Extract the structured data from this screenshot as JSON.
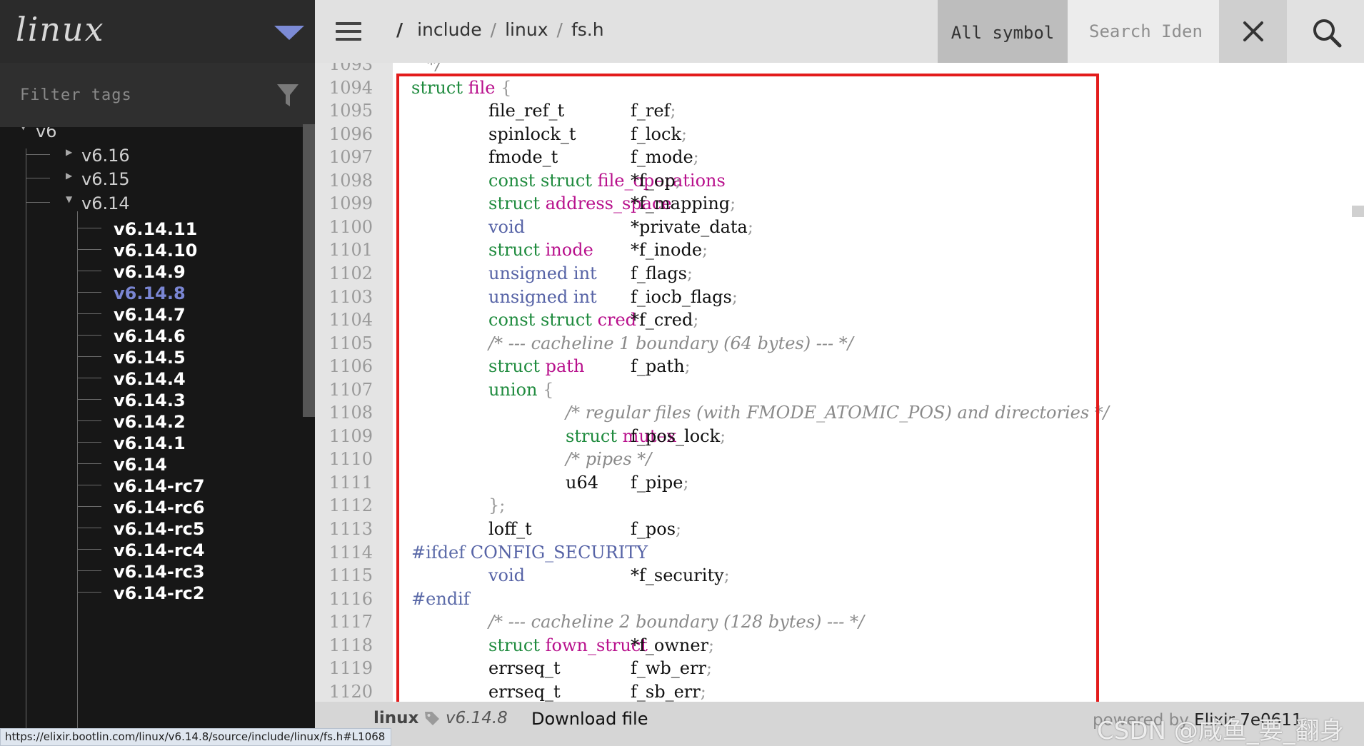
{
  "sidebar": {
    "logo": "linux",
    "filter_placeholder": "Filter tags",
    "tree": {
      "root": "v6",
      "groups": [
        "v6.16",
        "v6.15",
        "v6.14"
      ],
      "versions": [
        "v6.14.11",
        "v6.14.10",
        "v6.14.9",
        "v6.14.8",
        "v6.14.7",
        "v6.14.6",
        "v6.14.5",
        "v6.14.4",
        "v6.14.3",
        "v6.14.2",
        "v6.14.1",
        "v6.14",
        "v6.14-rc7",
        "v6.14-rc6",
        "v6.14-rc5",
        "v6.14-rc4",
        "v6.14-rc3",
        "v6.14-rc2"
      ],
      "active_version": "v6.14.8"
    }
  },
  "topbar": {
    "breadcrumb": [
      "include",
      "linux",
      "fs.h"
    ],
    "root_slash": "/",
    "search_type": "All symbol",
    "search_placeholder": "Search Iden"
  },
  "code": {
    "line_numbers": [
      "1093",
      "1094",
      "1095",
      "1096",
      "1097",
      "1098",
      "1099",
      "1100",
      "1101",
      "1102",
      "1103",
      "1104",
      "1105",
      "1106",
      "1107",
      "1108",
      "1109",
      "1110",
      "1111",
      "1112",
      "1113",
      "1114",
      "1115",
      "1116",
      "1117",
      "1118",
      "1119",
      "1120"
    ],
    "lines": {
      "l1093": "*/",
      "l1094": {
        "kw": "struct",
        "ty": "file",
        "rest": " {"
      },
      "l1095": {
        "type": "file_ref_t",
        "field": "f_ref"
      },
      "l1096": {
        "type": "spinlock_t",
        "field": "f_lock"
      },
      "l1097": {
        "type": "fmode_t",
        "field": "f_mode"
      },
      "l1098": {
        "kw": "const struct",
        "ty": "file_operations",
        "field": "*f_op"
      },
      "l1099": {
        "kw": "struct",
        "ty": "address_space",
        "field": "*f_mapping"
      },
      "l1100": {
        "bt": "void",
        "field": "*private_data"
      },
      "l1101": {
        "kw": "struct",
        "ty": "inode",
        "field": "*f_inode"
      },
      "l1102": {
        "bt": "unsigned int",
        "field": "f_flags"
      },
      "l1103": {
        "bt": "unsigned int",
        "field": "f_iocb_flags"
      },
      "l1104": {
        "kw": "const struct",
        "ty": "cred",
        "field": "*f_cred"
      },
      "l1105": "/* --- cacheline 1 boundary (64 bytes) --- */",
      "l1106": {
        "kw": "struct",
        "ty": "path",
        "field": "f_path"
      },
      "l1107": {
        "kw": "union",
        "rest": "{"
      },
      "l1108": "/* regular files (with FMODE_ATOMIC_POS) and directories */",
      "l1109": {
        "kw": "struct",
        "ty": "mutex",
        "field": "f_pos_lock"
      },
      "l1110": "/* pipes */",
      "l1111": {
        "type": "u64",
        "field": "f_pipe"
      },
      "l1112": "};",
      "l1113": {
        "type": "loff_t",
        "field": "f_pos"
      },
      "l1114": {
        "pp": "#ifdef",
        "macro": "CONFIG_SECURITY"
      },
      "l1115": {
        "bt": "void",
        "field": "*f_security"
      },
      "l1116": "#endif",
      "l1117": "/* --- cacheline 2 boundary (128 bytes) --- */",
      "l1118": {
        "kw": "struct",
        "ty": "fown_struct",
        "field": "*f_owner"
      },
      "l1119": {
        "type": "errseq_t",
        "field": "f_wb_err"
      },
      "l1120": {
        "type": "errseq_t",
        "field": "f_sb_err"
      }
    }
  },
  "footer": {
    "project": "linux",
    "version": "v6.14.8",
    "download": "Download file",
    "powered": "powered by",
    "powered_name": "Elixir 7e0611",
    "watermark": "CSDN @咸鱼_要_翻身"
  },
  "status_url": "https://elixir.bootlin.com/linux/v6.14.8/source/include/linux/fs.h#L1068",
  "colors": {
    "keyword": "#1f8b3e",
    "type_ident": "#b8108c",
    "builtin": "#5663a6",
    "comment": "#8a8a8a",
    "highlight_box": "#e31c1c",
    "active_version": "#7a86d3"
  }
}
